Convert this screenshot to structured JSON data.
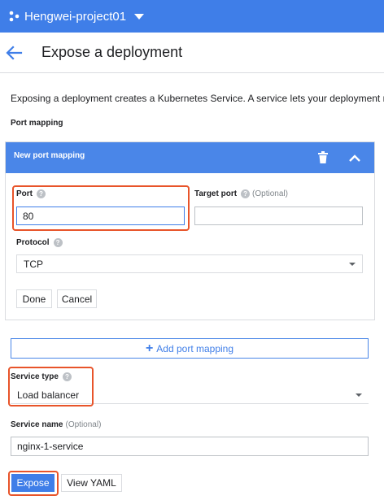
{
  "topbar": {
    "project_name": "Hengwei-project01",
    "icon": "project-hub-icon",
    "caret_icon": "caret-down-icon",
    "color": "#3f7ee8"
  },
  "header": {
    "back_icon": "arrow-back-icon",
    "title": "Expose a deployment"
  },
  "description": "Exposing a deployment creates a Kubernetes Service. A service lets your deployment re",
  "port_mapping": {
    "section_title": "Port mapping",
    "panel_title": "New port mapping",
    "delete_icon": "trash-icon",
    "collapse_icon": "chevron-up-icon",
    "port": {
      "label": "Port",
      "help": "?",
      "value": "80"
    },
    "target_port": {
      "label": "Target port",
      "help": "?",
      "optional": "(Optional)",
      "value": ""
    },
    "protocol": {
      "label": "Protocol",
      "help": "?",
      "value": "TCP"
    },
    "done_label": "Done",
    "cancel_label": "Cancel",
    "add_label": "Add port mapping",
    "add_symbol": "+"
  },
  "service_type": {
    "label": "Service type",
    "help": "?",
    "value": "Load balancer"
  },
  "service_name": {
    "label": "Service name",
    "optional": "(Optional)",
    "value": "nginx-1-service"
  },
  "actions": {
    "expose_label": "Expose",
    "view_yaml_label": "View YAML"
  },
  "colors": {
    "accent": "#3f7ee8",
    "highlight": "#e8542a"
  }
}
